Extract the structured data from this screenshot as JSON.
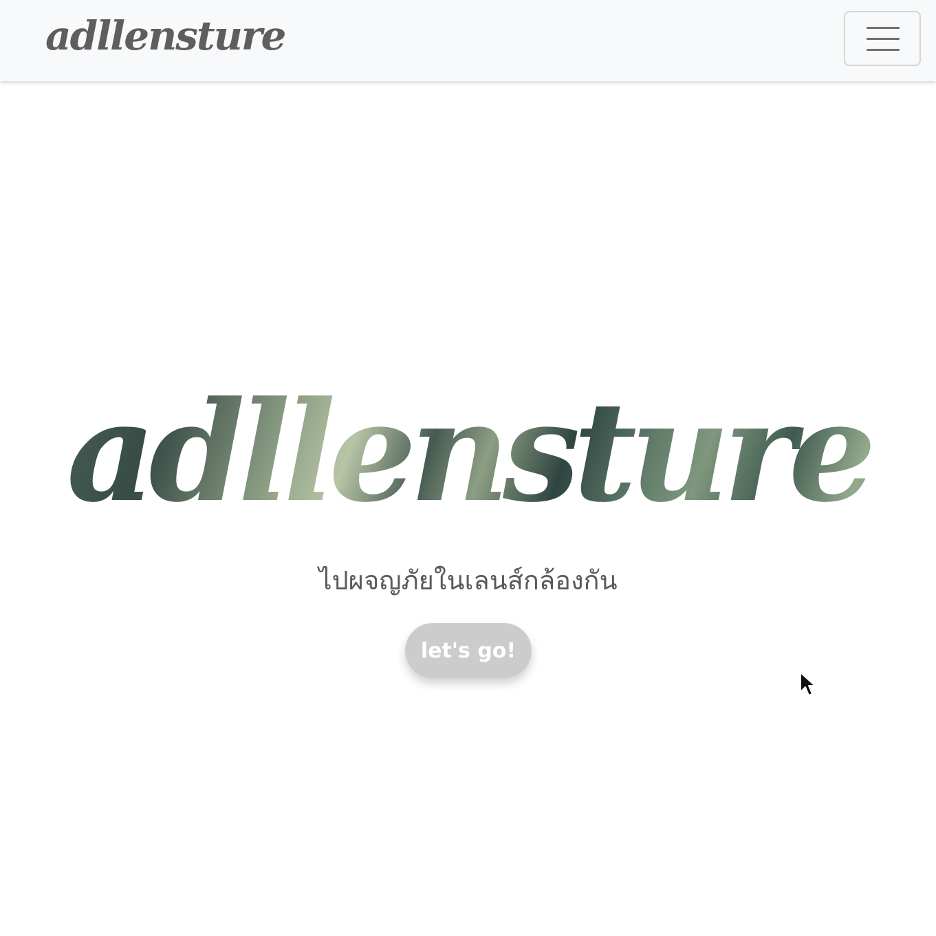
{
  "navbar": {
    "brand": "adllensture",
    "menu_icon": "hamburger-menu-icon"
  },
  "hero": {
    "title": "adllensture",
    "subtitle": "ไปผจญภัยในเลนส์กล้องกัน",
    "cta_label": "let's go!"
  },
  "colors": {
    "navbar_bg": "#f8f9fa",
    "brand_text": "#5e5e5e",
    "title_gradient_dark": "#2f4541",
    "title_gradient_light": "#b8c4a6",
    "subtitle_text": "#5a5a5a",
    "button_bg": "#cccccc",
    "button_text": "#ffffff"
  },
  "cursor_icon": "mouse-pointer-icon"
}
